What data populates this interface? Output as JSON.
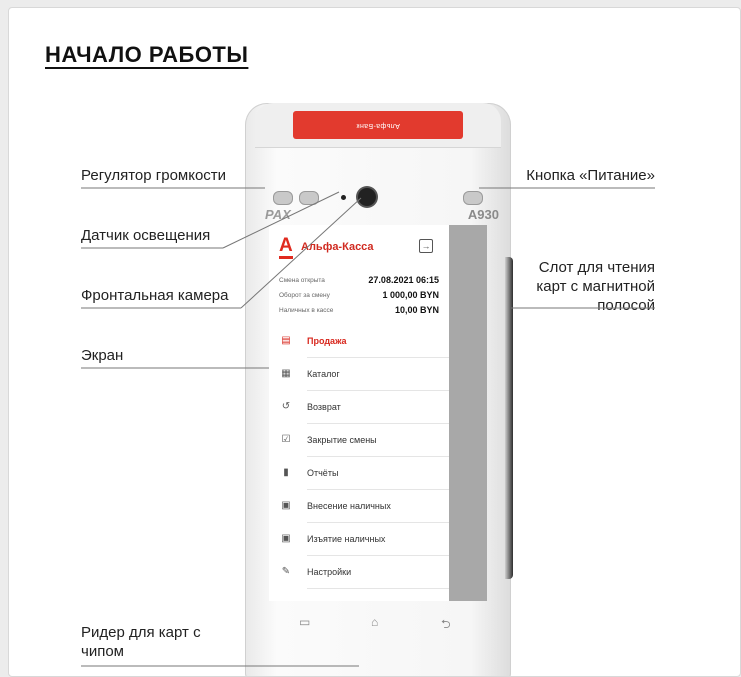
{
  "title": "НАЧАЛО РАБОТЫ",
  "labels": {
    "volume": "Регулятор громкости",
    "light_sensor": "Датчик освещения",
    "front_camera": "Фронтальная камера",
    "screen": "Экран",
    "chip_reader": "Ридер для карт с чипом",
    "power": "Кнопка «Питание»",
    "card_slot": "Слот для чтения карт с магнитной полосой"
  },
  "device": {
    "brand": "PAX",
    "model": "A930",
    "paper_text": "Альфа-Банк",
    "app": {
      "logo": "А",
      "name": "Альфа-Касса",
      "info": [
        {
          "label": "Смена открыта",
          "value": "27.08.2021 06:15"
        },
        {
          "label": "Оборот за смену",
          "value": "1 000,00 BYN"
        },
        {
          "label": "Наличных в кассе",
          "value": "10,00 BYN"
        }
      ],
      "menu": [
        {
          "label": "Продажа",
          "icon": "receipt-icon",
          "active": true
        },
        {
          "label": "Каталог",
          "icon": "grid-icon",
          "active": false
        },
        {
          "label": "Возврат",
          "icon": "undo-icon",
          "active": false
        },
        {
          "label": "Закрытие смены",
          "icon": "check-icon",
          "active": false
        },
        {
          "label": "Отчёты",
          "icon": "book-icon",
          "active": false
        },
        {
          "label": "Внесение наличных",
          "icon": "cash-in-icon",
          "active": false
        },
        {
          "label": "Изъятие наличных",
          "icon": "cash-out-icon",
          "active": false
        },
        {
          "label": "Настройки",
          "icon": "wrench-icon",
          "active": false
        }
      ]
    },
    "nav_icons": [
      "recent-apps-icon",
      "home-icon",
      "back-icon"
    ]
  },
  "colors": {
    "accent": "#e02a1f"
  }
}
